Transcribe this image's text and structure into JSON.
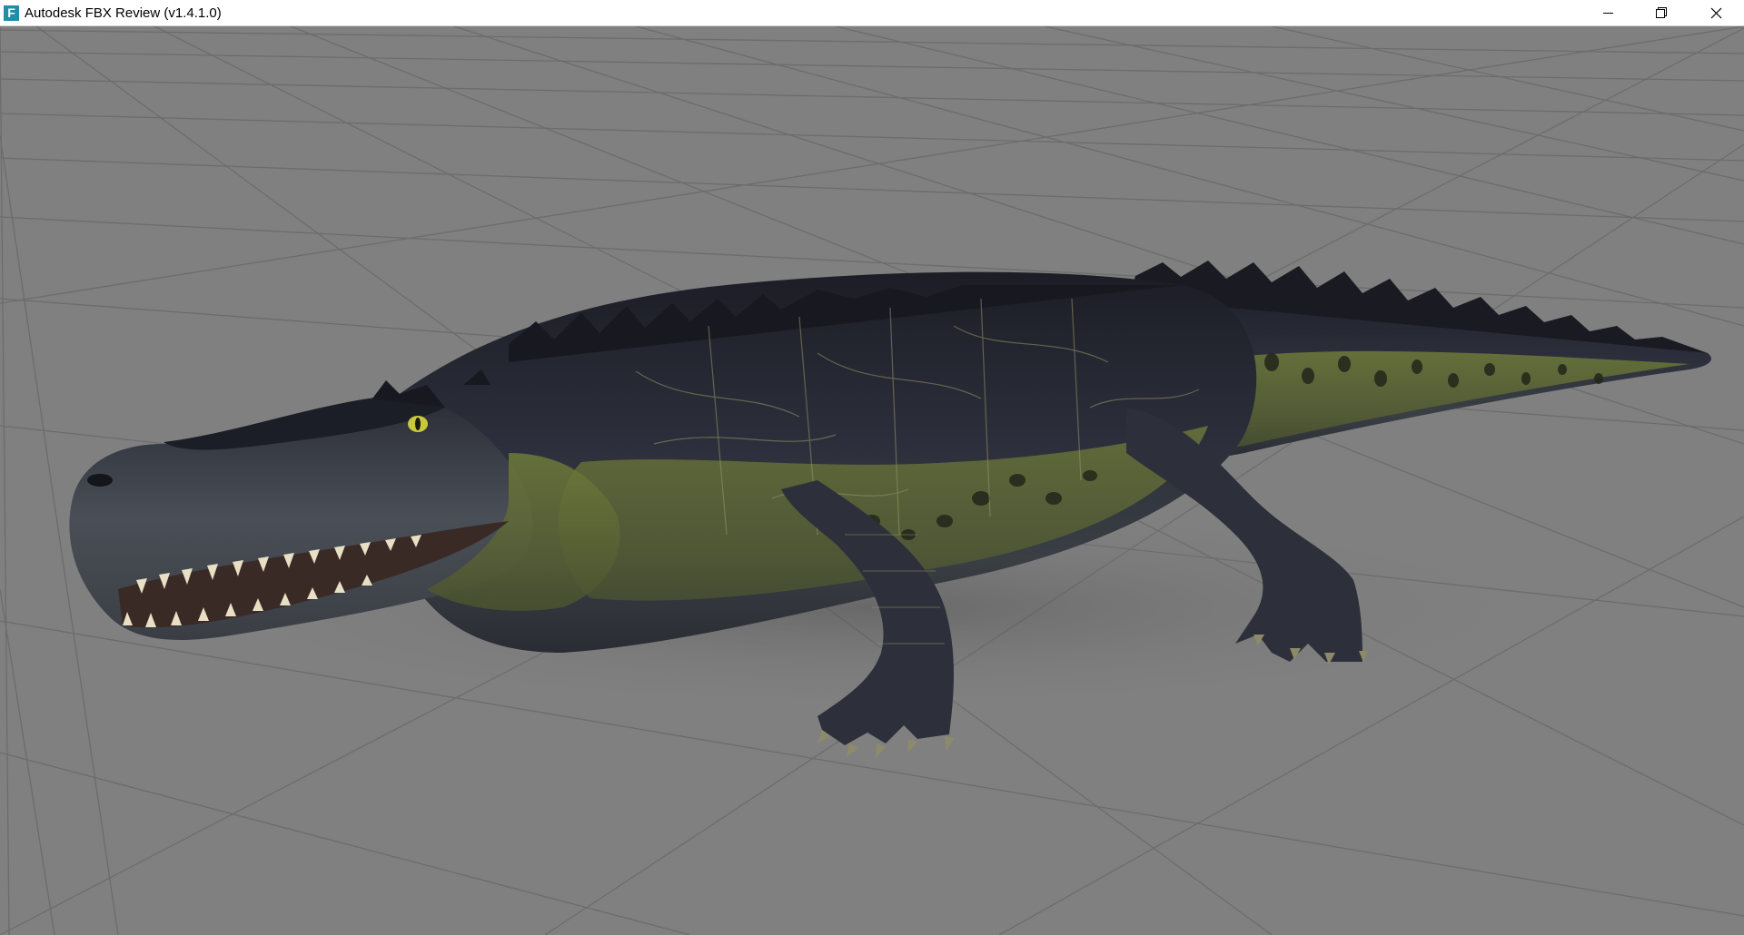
{
  "window": {
    "title": "Autodesk FBX Review (v1.4.1.0)",
    "app_icon_letter": "F",
    "app_icon": "fbx-review-logo-icon",
    "controls": {
      "minimize_icon": "minimize-icon",
      "restore_icon": "restore-icon",
      "close_icon": "close-icon"
    }
  },
  "viewport": {
    "background_color": "#808080",
    "grid_color": "#6c6c6c",
    "grid_visible": true,
    "model": "alligator"
  }
}
